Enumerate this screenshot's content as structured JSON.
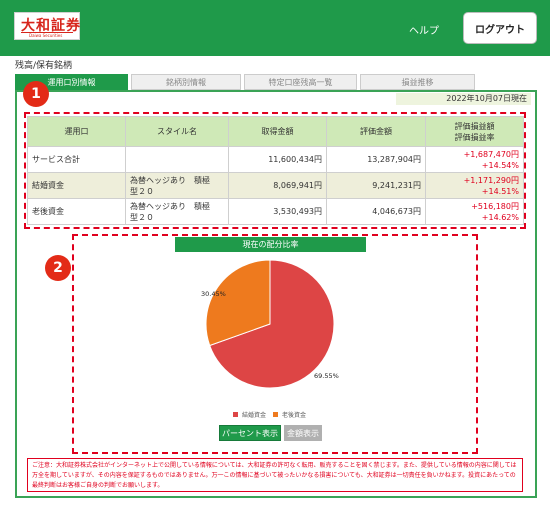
{
  "header": {
    "logo_text": "大和証券",
    "logo_sub": "Daiwa Securities",
    "help_label": "ヘルプ",
    "logout_label": "ログアウト"
  },
  "page_title": "残高/保有銘柄",
  "tabs": [
    {
      "label": "運用口別情報",
      "active": true
    },
    {
      "label": "銘柄別情報",
      "active": false
    },
    {
      "label": "特定口座残高一覧",
      "active": false
    },
    {
      "label": "損益推移",
      "active": false
    }
  ],
  "as_of_date": "2022年10月07日現在",
  "table": {
    "headers": {
      "account": "運用口",
      "style": "スタイル名",
      "cost": "取得金額",
      "value": "評価金額",
      "pl_line1": "評価損益額",
      "pl_line2": "評価損益率"
    },
    "rows": [
      {
        "account": "サービス合計",
        "style_line1": "",
        "style_line2": "",
        "cost": "11,600,434円",
        "value": "13,287,904円",
        "pl_amount": "+1,687,470円",
        "pl_rate": "+14.54%"
      },
      {
        "account": "結婚資金",
        "style_line1": "為替ヘッジあり　積極",
        "style_line2": "型２０",
        "cost": "8,069,941円",
        "value": "9,241,231円",
        "pl_amount": "+1,171,290円",
        "pl_rate": "+14.51%"
      },
      {
        "account": "老後資金",
        "style_line1": "為替ヘッジあり　積極",
        "style_line2": "型２０",
        "cost": "3,530,493円",
        "value": "4,046,673円",
        "pl_amount": "+516,180円",
        "pl_rate": "+14.62%"
      }
    ]
  },
  "badges": {
    "one": "1",
    "two": "2"
  },
  "chart_data": {
    "type": "pie",
    "title": "現在の配分比率",
    "categories": [
      "結婚資金",
      "老後資金"
    ],
    "values": [
      69.55,
      30.45
    ],
    "value_labels": [
      "69.55%",
      "30.45%"
    ],
    "colors": [
      "#dd4545",
      "#ee7a1e"
    ],
    "legend_position": "bottom"
  },
  "chart_buttons": {
    "percent": "パーセント表示",
    "amount": "金額表示"
  },
  "notice": "ご注意：大和証券株式会社がインターネット上で公開している情報については、大和証券の許可なく転用、販売することを固く禁じます。また、提供している情報の内容に関しては万全を期していますが、その内容を保証するものではありません。万一この情報に基づいて被ったいかなる損害についても、大和証券は一切責任を負いかねます。投資にあたっての最終判断はお客様ご自身の判断でお願いします。"
}
